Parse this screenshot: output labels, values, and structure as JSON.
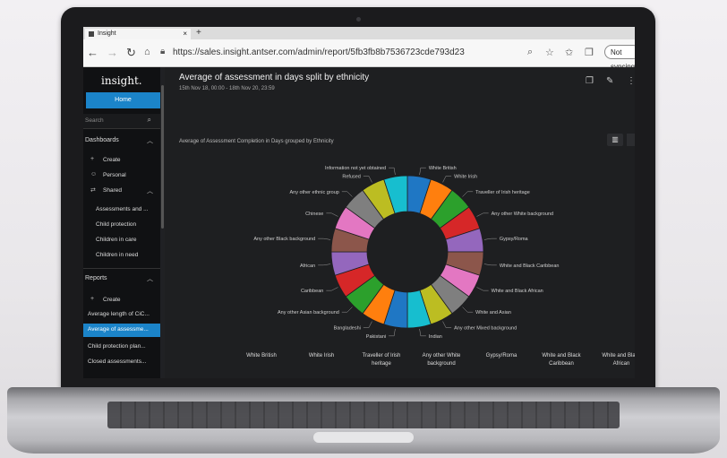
{
  "browser": {
    "tab_title": "Insight",
    "new_tab": "+",
    "url": "https://sales.insight.antser.com/admin/report/5fb3fb8b7536723cde793d23",
    "profile_label": "Not syncing"
  },
  "sidebar": {
    "logo": "insight.",
    "home_label": "Home",
    "search_placeholder": "Search",
    "dashboards_header": "Dashboards",
    "dashboard_items": [
      {
        "label": "Create",
        "icon": "plus-icon"
      },
      {
        "label": "Personal",
        "icon": "user-icon"
      },
      {
        "label": "Shared",
        "icon": "share-icon"
      }
    ],
    "shared_items": [
      "Assessments and ...",
      "Child protection",
      "Children in care",
      "Children in need"
    ],
    "reports_header": "Reports",
    "report_create": "Create",
    "report_items": [
      "Average length of CiC...",
      "Average of assessme...",
      "Child protection plan...",
      "Closed assessments..."
    ],
    "active_report_index": 1
  },
  "report": {
    "title": "Average of assessment in days split by ethnicity",
    "date_range": "15th Nov 18, 00:00 - 18th Nov 20, 23:59",
    "chart_subtitle": "Average of Assessment Completion in Days grouped by Ethnicity"
  },
  "chart_data": {
    "type": "pie",
    "subtype": "donut",
    "title": "Average of Assessment Completion in Days grouped by Ethnicity",
    "categories": [
      "White British",
      "White Irish",
      "Traveller of Irish heritage",
      "Any other White background",
      "Gypsy/Roma",
      "White and Black Caribbean",
      "White and Black African",
      "White and Asian",
      "Any other Mixed background",
      "Indian",
      "Pakistani",
      "Bangladeshi",
      "Any other Asian background",
      "Caribbean",
      "African",
      "Any other Black background",
      "Chinese",
      "Any other ethnic group",
      "Refused",
      "Information not yet obtained"
    ],
    "values": [
      5,
      5,
      5,
      5,
      5,
      5,
      5,
      5,
      5,
      5,
      5,
      5,
      5,
      5,
      5,
      5,
      5,
      5,
      5,
      5
    ],
    "colors": [
      "#1f77c4",
      "#ff7f0e",
      "#2ca02c",
      "#d62728",
      "#9467bd",
      "#8c564b",
      "#e377c2",
      "#7f7f7f",
      "#bcbd22",
      "#17becf",
      "#1f77c4",
      "#ff7f0e",
      "#2ca02c",
      "#d62728",
      "#9467bd",
      "#8c564b",
      "#e377c2",
      "#7f7f7f",
      "#bcbd22",
      "#17becf"
    ],
    "legend_placement": "bottom"
  },
  "legend_visible": [
    "White British",
    "White Irish",
    "Traveller of Irish heritage",
    "Any other White background",
    "Gypsy/Roma",
    "White and Black Caribbean",
    "White and Black African"
  ],
  "toolbar_icons": [
    "duplicate-icon",
    "edit-icon",
    "more-icon"
  ]
}
